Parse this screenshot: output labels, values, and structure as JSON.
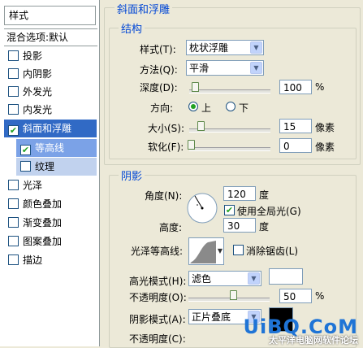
{
  "styles_panel": {
    "header": "样式",
    "blend_options": "混合选项:默认",
    "items": [
      {
        "label": "投影",
        "checked": false
      },
      {
        "label": "内阴影",
        "checked": false
      },
      {
        "label": "外发光",
        "checked": false
      },
      {
        "label": "内发光",
        "checked": false
      },
      {
        "label": "斜面和浮雕",
        "checked": true
      },
      {
        "label": "等高线",
        "checked": true
      },
      {
        "label": "纹理",
        "checked": false
      },
      {
        "label": "光泽",
        "checked": false
      },
      {
        "label": "颜色叠加",
        "checked": false
      },
      {
        "label": "渐变叠加",
        "checked": false
      },
      {
        "label": "图案叠加",
        "checked": false
      },
      {
        "label": "描边",
        "checked": false
      }
    ]
  },
  "bevel": {
    "title": "斜面和浮雕",
    "structure_title": "结构",
    "style_label": "样式(T):",
    "style_value": "枕状浮雕",
    "technique_label": "方法(Q):",
    "technique_value": "平滑",
    "depth_label": "深度(D):",
    "depth_value": "100",
    "depth_unit": "%",
    "direction_label": "方向:",
    "direction_up": "上",
    "direction_down": "下",
    "size_label": "大小(S):",
    "size_value": "15",
    "size_unit": "像素",
    "soften_label": "软化(F):",
    "soften_value": "0",
    "soften_unit": "像素"
  },
  "shading": {
    "title": "阴影",
    "angle_label": "角度(N):",
    "angle_value": "120",
    "angle_unit": "度",
    "global_light_label": "使用全局光(G)",
    "altitude_label": "高度:",
    "altitude_value": "30",
    "altitude_unit": "度",
    "gloss_contour_label": "光泽等高线:",
    "anti_alias_label": "消除锯齿(L)",
    "highlight_mode_label": "高光模式(H):",
    "highlight_mode_value": "滤色",
    "highlight_opacity_label": "不透明度(O):",
    "highlight_opacity_value": "50",
    "opacity_unit": "%",
    "shadow_mode_label": "阴影模式(A):",
    "shadow_mode_value": "正片叠底",
    "shadow_opacity_label": "不透明度(C):"
  },
  "watermark": {
    "logo": "UiBQ.CoM",
    "sub": "太平洋电脑网软件论坛"
  },
  "colors": {
    "selected": "#316ac5",
    "section_title": "#0046d5",
    "highlight_swatch": "#ffffff",
    "shadow_swatch": "#000000"
  }
}
